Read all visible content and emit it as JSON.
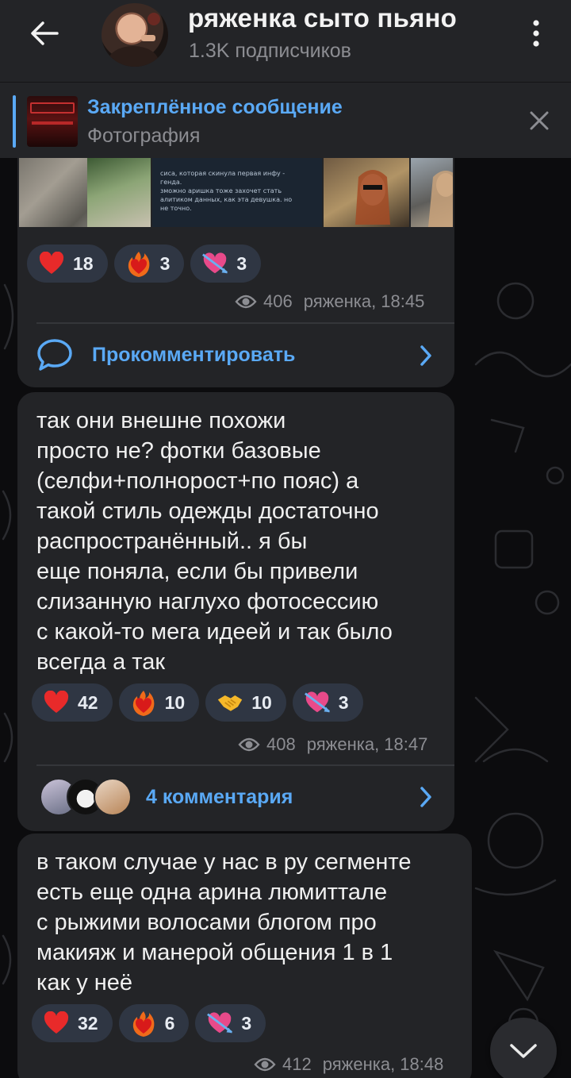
{
  "header": {
    "back_icon": "arrow-left-icon",
    "title": "ряженка сыто пьяно",
    "subtitle": "1.3K подписчиков",
    "menu_icon": "more-vertical-icon"
  },
  "pinned": {
    "title": "Закреплённое сообщение",
    "subtitle": "Фотография",
    "close_icon": "close-icon"
  },
  "messages": [
    {
      "reactions": [
        {
          "emoji": "heart",
          "count": "18"
        },
        {
          "emoji": "heart-on-fire",
          "count": "3"
        },
        {
          "emoji": "heart-with-arrow",
          "count": "3"
        }
      ],
      "views": "406",
      "author_time": "ряженка, 18:45",
      "comment_label": "Прокомментировать",
      "photo_caption_lines": [
        "сиса, которая скинула первая инфу -",
        "генда.",
        "зможно аришка тоже захочет стать",
        "алитиком данных, как эта девушка. но",
        "не точно."
      ]
    },
    {
      "text": "так они внешне похожи\nпросто не? фотки базовые\n(селфи+полнорост+по пояс) а\nтакой стиль одежды достаточно\nраспространённый.. я бы\nеще поняла, если бы привели\nслизанную наглухо фотосессию\nс какой-то мега идеей и так было\nвсегда а так",
      "reactions": [
        {
          "emoji": "heart",
          "count": "42"
        },
        {
          "emoji": "heart-on-fire",
          "count": "10"
        },
        {
          "emoji": "handshake",
          "count": "10"
        },
        {
          "emoji": "heart-with-arrow",
          "count": "3"
        }
      ],
      "views": "408",
      "author_time": "ряженка, 18:47",
      "comment_label": "4 комментария"
    },
    {
      "text": "в таком случае у нас в ру сегменте\nесть еще одна арина люмиттале\nс рыжими волосами блогом про\nмакияж и манерой общения 1 в 1\nкак у неё",
      "reactions": [
        {
          "emoji": "heart",
          "count": "32"
        },
        {
          "emoji": "heart-on-fire",
          "count": "6"
        },
        {
          "emoji": "heart-with-arrow",
          "count": "3"
        }
      ],
      "views": "412",
      "author_time": "ряженка, 18:48"
    }
  ],
  "colors": {
    "accent": "#5aa9f5",
    "bubble": "#232427",
    "reaction_pill": "#2f3643",
    "background": "#0c0c0e"
  }
}
